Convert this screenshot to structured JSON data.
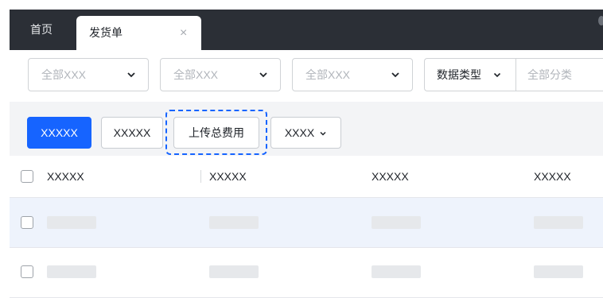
{
  "tabs": {
    "home_label": "首页",
    "active_label": "发货单",
    "close_glyph": "×"
  },
  "filters": {
    "select1_placeholder": "全部XXX",
    "select2_placeholder": "全部XXX",
    "select3_placeholder": "全部XXX",
    "data_type_label": "数据类型",
    "category_placeholder": "全部分类"
  },
  "actions": {
    "primary_label": "XXXXX",
    "secondary_label": "XXXXX",
    "upload_label": "上传总费用",
    "dropdown_label": "XXXX"
  },
  "table": {
    "columns": [
      "XXXXX",
      "XXXXX",
      "XXXXX",
      "XXXXX"
    ]
  },
  "colors": {
    "tabbar_bg": "#2b2f36",
    "primary": "#1664ff",
    "action_bar_bg": "#f3f4f6",
    "selected_row_bg": "#eef3fc"
  }
}
